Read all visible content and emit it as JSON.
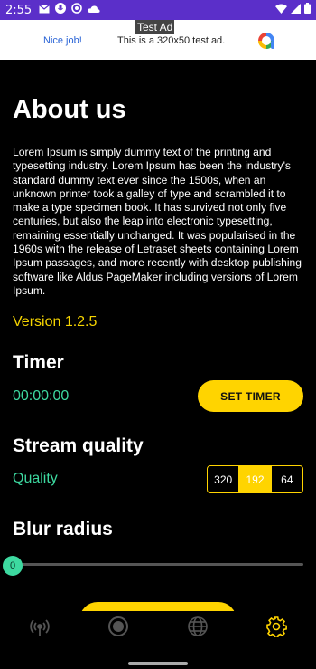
{
  "status_bar": {
    "time": "2:55",
    "left_icons": [
      "gmail-icon",
      "mic-icon",
      "no-disturb-icon",
      "cloud-icon"
    ],
    "right_icons": [
      "wifi-icon",
      "signal-icon",
      "battery-icon"
    ],
    "color": "#5b2fc9"
  },
  "ad": {
    "tag": "Test Ad",
    "nice": "Nice job!",
    "text": "This is a 320x50 test ad.",
    "logo": "admob-logo-icon"
  },
  "page": {
    "title": "About us",
    "about_text": "Lorem Ipsum is simply dummy text of the printing and typesetting industry. Lorem Ipsum has been the industry's standard dummy text ever since the 1500s, when an unknown printer took a galley of type and scrambled it to make a type specimen book. It has survived not only five centuries, but also the leap into electronic typesetting, remaining essentially unchanged. It was popularised in the 1960s with the release of Letraset sheets containing Lorem Ipsum passages, and more recently with desktop publishing software like Aldus PageMaker including versions of Lorem Ipsum.",
    "version": "Version 1.2.5"
  },
  "timer": {
    "title": "Timer",
    "value": "00:00:00",
    "button": "SET TIMER"
  },
  "stream": {
    "title": "Stream quality",
    "label": "Quality",
    "options": [
      "320",
      "192",
      "64"
    ],
    "selected": "192"
  },
  "blur": {
    "title": "Blur radius",
    "value": "0"
  },
  "nav": {
    "items": [
      "radio-tower-icon",
      "record-icon",
      "globe-icon",
      "settings-gear-icon"
    ],
    "active": "settings-gear-icon"
  },
  "colors": {
    "accent_yellow": "#ffd400",
    "accent_green": "#3dd9a0",
    "background": "#000000"
  }
}
